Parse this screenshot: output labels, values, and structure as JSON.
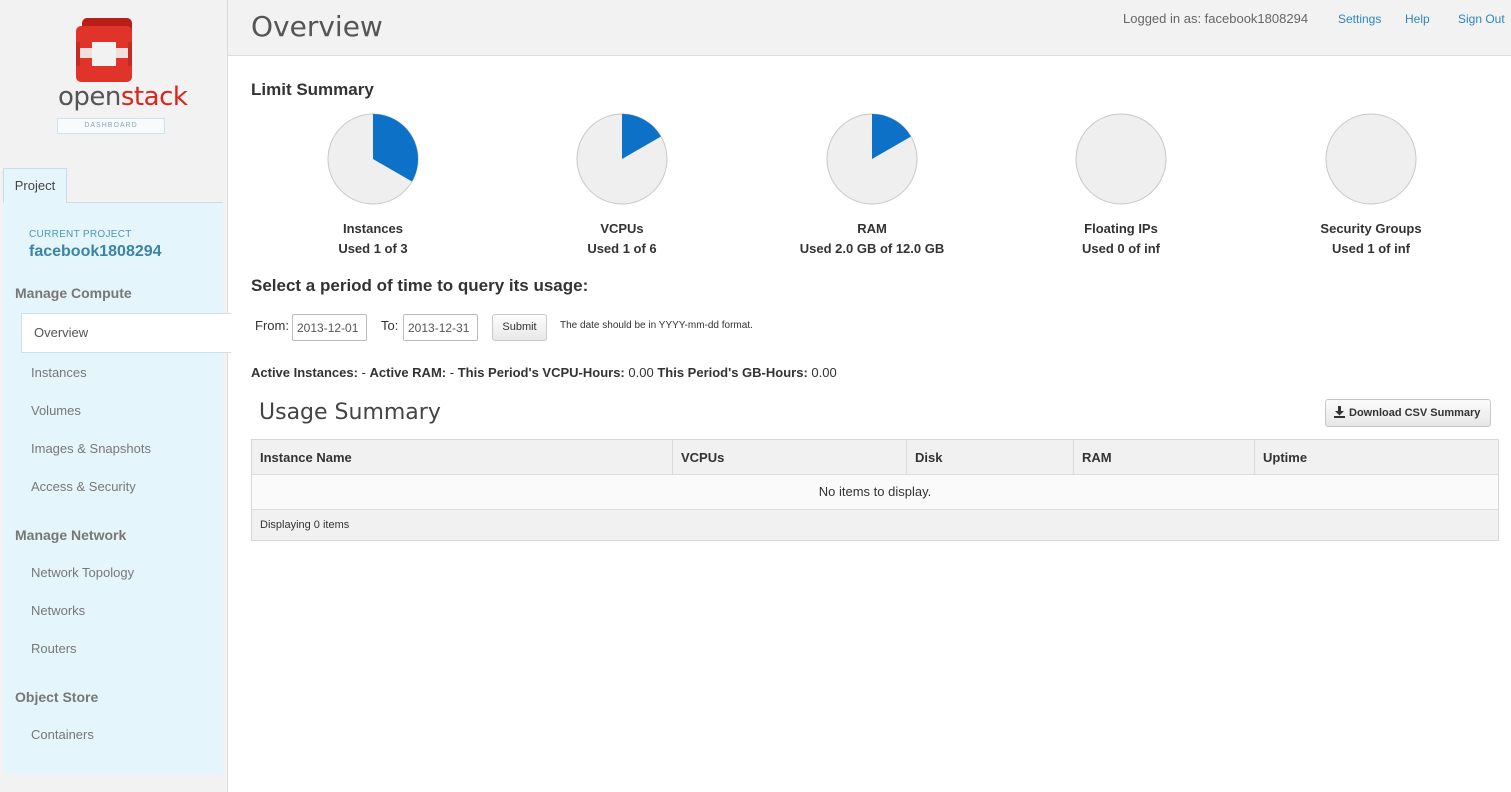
{
  "brand": {
    "name_plain": "open",
    "name_accent": "stack",
    "subtitle": "DASHBOARD"
  },
  "sidebar": {
    "tab_label": "Project",
    "current_project_label": "CURRENT PROJECT",
    "current_project": "facebook1808294",
    "sections": [
      {
        "title": "Manage Compute",
        "items": [
          "Overview",
          "Instances",
          "Volumes",
          "Images & Snapshots",
          "Access & Security"
        ]
      },
      {
        "title": "Manage Network",
        "items": [
          "Network Topology",
          "Networks",
          "Routers"
        ]
      },
      {
        "title": "Object Store",
        "items": [
          "Containers"
        ]
      }
    ],
    "active_item": "Overview"
  },
  "header": {
    "title": "Overview",
    "logged_in": "Logged in as: facebook1808294",
    "links": [
      "Settings",
      "Help",
      "Sign Out"
    ]
  },
  "limit_summary": {
    "heading": "Limit Summary",
    "items": [
      {
        "name": "Instances",
        "used_text": "Used 1 of 3",
        "fraction": 0.3333
      },
      {
        "name": "VCPUs",
        "used_text": "Used 1 of 6",
        "fraction": 0.1667
      },
      {
        "name": "RAM",
        "used_text": "Used 2.0 GB of 12.0 GB",
        "fraction": 0.1667
      },
      {
        "name": "Floating IPs",
        "used_text": "Used 0 of inf",
        "fraction": 0
      },
      {
        "name": "Security Groups",
        "used_text": "Used 1 of inf",
        "fraction": 0
      }
    ],
    "colors": {
      "used": "#0c71c7",
      "free": "#efefef",
      "stroke": "#c8c8c8"
    }
  },
  "period": {
    "heading": "Select a period of time to query its usage:",
    "from_label": "From:",
    "from_value": "2013-12-01",
    "to_label": "To:",
    "to_value": "2013-12-31",
    "submit_label": "Submit",
    "hint": "The date should be in YYYY-mm-dd format."
  },
  "stats": [
    {
      "label": "Active Instances:",
      "value": "-"
    },
    {
      "label": "Active RAM:",
      "value": "-"
    },
    {
      "label": "This Period's VCPU-Hours:",
      "value": "0.00"
    },
    {
      "label": "This Period's GB-Hours:",
      "value": "0.00"
    }
  ],
  "usage": {
    "heading": "Usage Summary",
    "download_label": "Download CSV Summary",
    "columns": [
      "Instance Name",
      "VCPUs",
      "Disk",
      "RAM",
      "Uptime"
    ],
    "empty_text": "No items to display.",
    "footer": "Displaying 0 items"
  }
}
